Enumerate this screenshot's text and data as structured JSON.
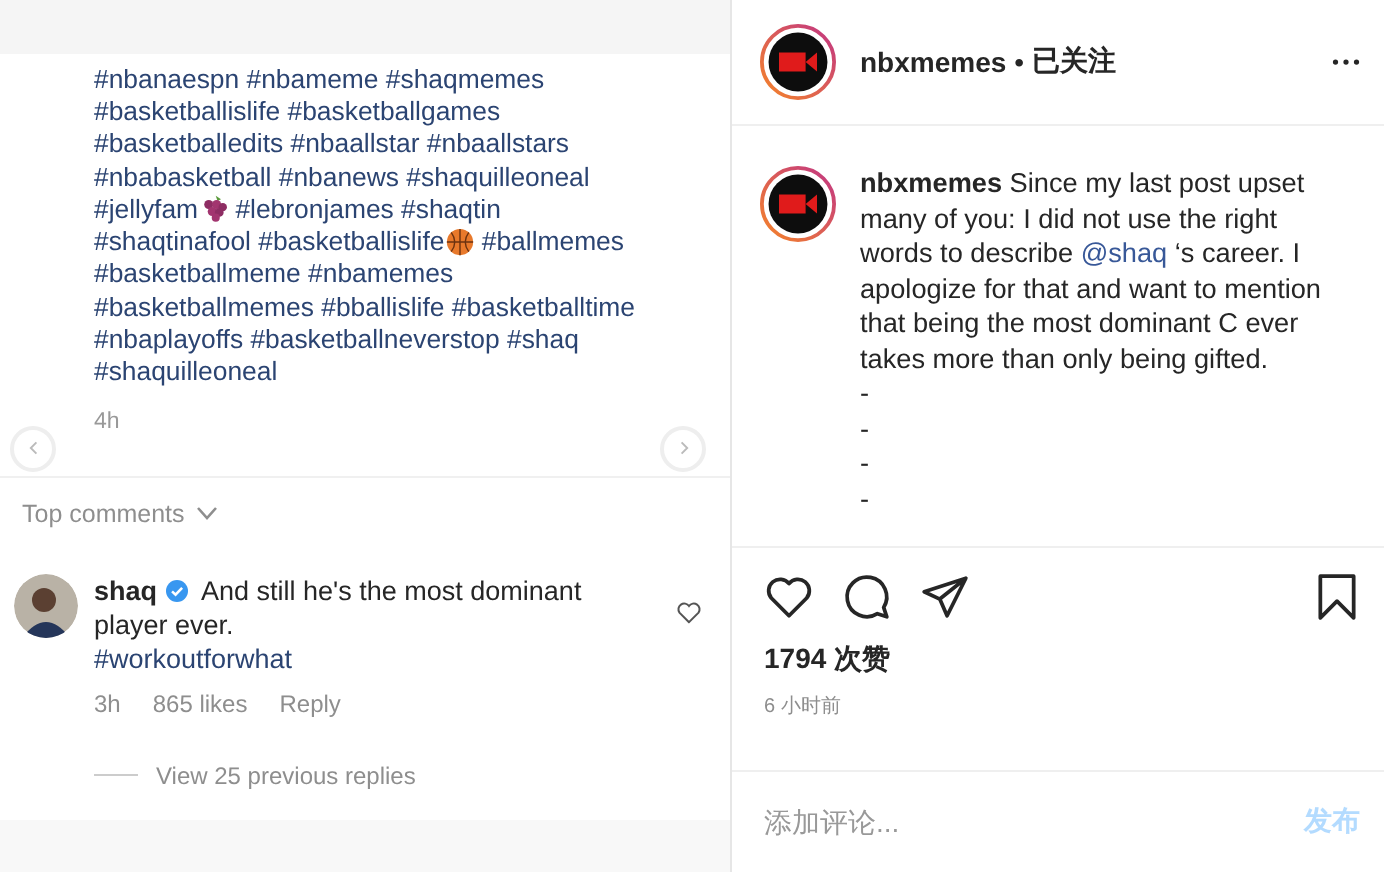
{
  "post_panel": {
    "hashtag_lines": [
      [
        {
          "kind": "text",
          "text": "#nbanaespn #nbameme #shaqmemes"
        }
      ],
      [
        {
          "kind": "text",
          "text": "#basketballislife #basketballgames"
        }
      ],
      [
        {
          "kind": "text",
          "text": "#basketballedits #nbaallstar #nbaallstars"
        }
      ],
      [
        {
          "kind": "text",
          "text": "#nbabasketball #nbanews #shaquilleoneal"
        }
      ],
      [
        {
          "kind": "text",
          "text": "#jellyfam"
        },
        {
          "kind": "grapes"
        },
        {
          "kind": "text",
          "text": " #lebronjames #shaqtin"
        }
      ],
      [
        {
          "kind": "text",
          "text": "#shaqtinafool #basketballislife"
        },
        {
          "kind": "basketball"
        },
        {
          "kind": "text",
          "text": " #ballmemes"
        }
      ],
      [
        {
          "kind": "text",
          "text": "#basketballmeme #nbamemes"
        }
      ],
      [
        {
          "kind": "text",
          "text": "#basketballmemes #bballislife #basketballtime"
        }
      ],
      [
        {
          "kind": "text",
          "text": "#nbaplayoffs #basketballneverstop #shaq"
        }
      ],
      [
        {
          "kind": "text",
          "text": "#shaquilleoneal"
        }
      ]
    ],
    "time": "4h",
    "comments_header": "Top comments",
    "comment": {
      "user": "shaq",
      "verified": true,
      "text": "And still he's the most dominant player ever.",
      "tag": "#workoutforwhat",
      "time": "3h",
      "likes": "865 likes",
      "reply": "Reply",
      "view_replies": "View 25 previous replies"
    }
  },
  "detail_panel": {
    "header": {
      "username": "nbxmemes",
      "separator": "•",
      "follow": "已关注"
    },
    "caption": {
      "user": "nbxmemes",
      "before": "Since my last post upset many of you: I did not use the right words to describe ",
      "mention": "@shaq",
      "after": " ‘s career. I apologize for that and want to mention that being the most dominant C ever takes more than only being gifted.",
      "dashes": [
        "-",
        "-",
        "-",
        "-"
      ]
    },
    "likes": "1794 次赞",
    "time": "6 小时前",
    "comment_placeholder": "添加评论...",
    "post_button": "发布"
  }
}
